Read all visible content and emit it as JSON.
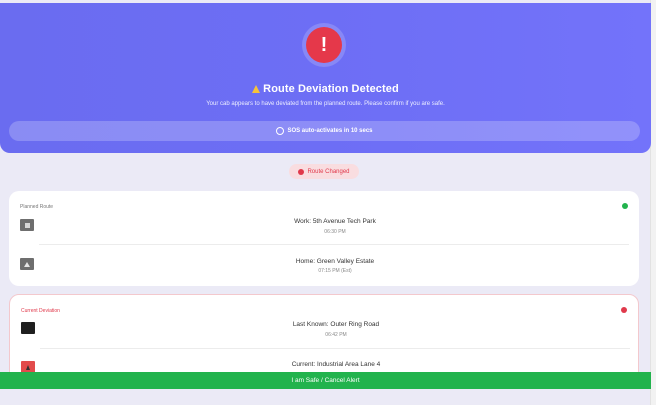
{
  "alert": {
    "icon_glyph": "!",
    "title": "Route Deviation Detected",
    "subtitle": "Your cab appears to have deviated from the planned route. Please confirm if you are safe.",
    "sos_text": "SOS auto-activates in 10 secs"
  },
  "badge": {
    "text": "Route Changed"
  },
  "planned": {
    "label": "Planned Route",
    "status_color": "#22b34d",
    "stops": [
      {
        "name": "Work: 5th Avenue Tech Park",
        "time": "06:30 PM",
        "icon": "building-icon"
      },
      {
        "name": "Home: Green Valley Estate",
        "time": "07:15 PM (Est)",
        "icon": "home-icon"
      }
    ]
  },
  "deviation": {
    "label": "Current Deviation",
    "status_color": "#e0394b",
    "stops": [
      {
        "name": "Last Known: Outer Ring Road",
        "time": "06:42 PM",
        "icon": "location-icon"
      },
      {
        "name": "Current: Industrial Area Lane 4",
        "time": "",
        "icon": "warning-icon"
      }
    ]
  },
  "actions": {
    "safe_label": "I am Safe / Cancel Alert"
  },
  "colors": {
    "header": "#6d6ef5",
    "danger": "#e5384a",
    "success": "#22b34d",
    "background": "#ebeaf6"
  }
}
